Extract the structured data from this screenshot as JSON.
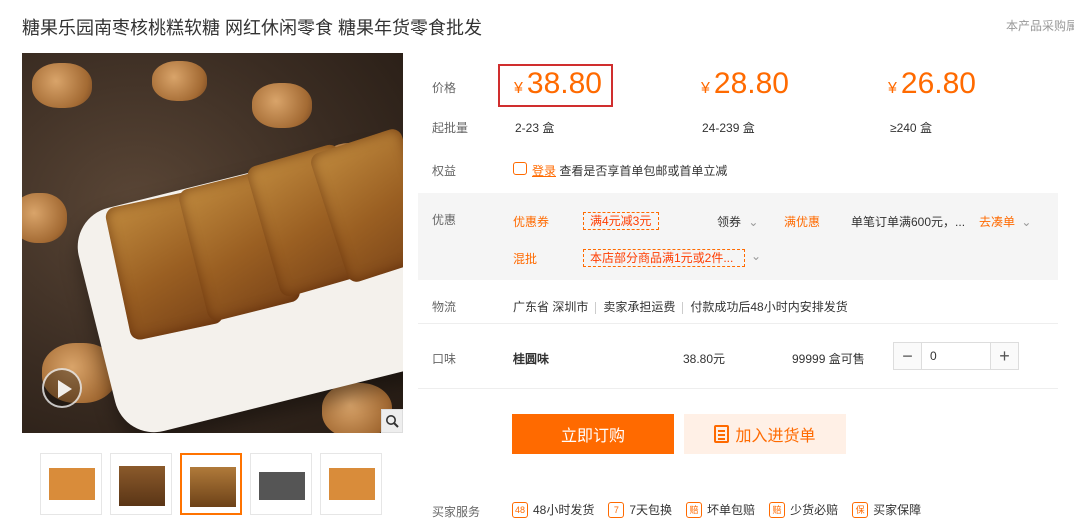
{
  "product": {
    "title": "糖果乐园南枣核桃糕软糖 网红休闲零食 糖果年货零食批发",
    "top_note": "本产品采购属"
  },
  "gallery": {
    "thumb_count": 5,
    "active_index": 2
  },
  "pricing": {
    "price_label": "价格",
    "min_order_label": "起批量",
    "currency": "¥",
    "tiers": [
      {
        "price": "38.80",
        "range": "2-23 盒"
      },
      {
        "price": "28.80",
        "range": "24-239 盒"
      },
      {
        "price": "26.80",
        "range": "≥240 盒"
      }
    ]
  },
  "benefits": {
    "label": "权益",
    "login_link": "登录",
    "text": "查看是否享首单包邮或首单立减"
  },
  "promotions": {
    "label": "优惠",
    "coupon_label": "优惠券",
    "coupon_tag": "满4元减3元",
    "coupon_action": "领券",
    "full_discount_label": "满优惠",
    "full_discount_text": "单笔订单满600元，...",
    "full_discount_action": "去凑单",
    "mix_label": "混批",
    "mix_tag": "本店部分商品满1元或2件..."
  },
  "logistics": {
    "label": "物流",
    "location": "广东省 深圳市",
    "freight": "卖家承担运费",
    "dispatch": "付款成功后48小时内安排发货"
  },
  "flavor": {
    "label": "口味",
    "name": "桂圆味",
    "price": "38.80元",
    "stock": "99999 盒可售",
    "quantity": "0"
  },
  "actions": {
    "buy": "立即订购",
    "add_to_cart": "加入进货单"
  },
  "services": {
    "label": "买家服务",
    "items": [
      {
        "icon": "48",
        "label": "48小时发货"
      },
      {
        "icon": "7",
        "label": "7天包换"
      },
      {
        "icon": "赔",
        "label": "坏单包赔"
      },
      {
        "icon": "赔",
        "label": "少货必赔"
      },
      {
        "icon": "保",
        "label": "买家保障"
      }
    ]
  },
  "colors": {
    "accent": "#ff6a00",
    "highlight_box": "#d02e2e"
  }
}
